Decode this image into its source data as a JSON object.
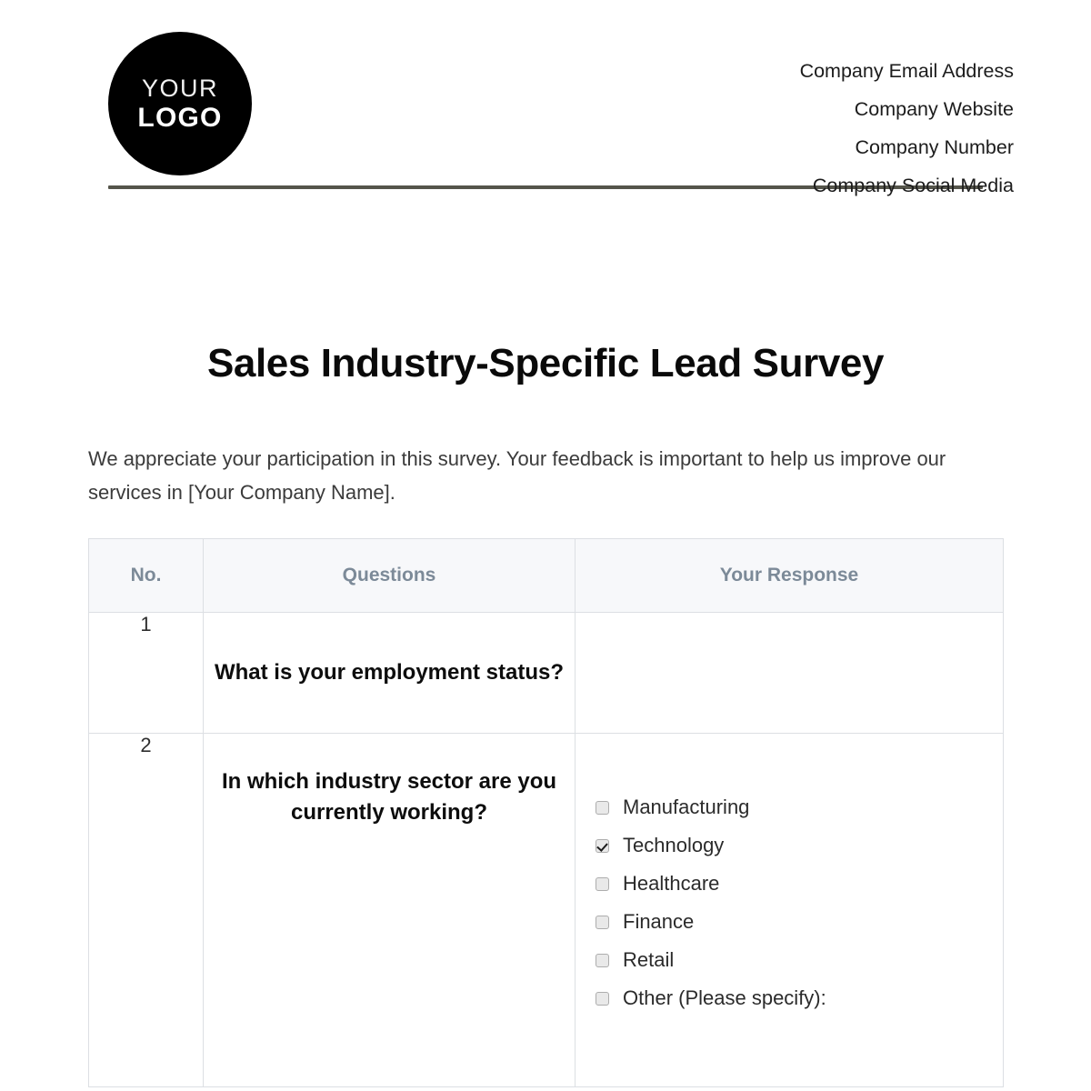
{
  "header": {
    "logo": {
      "top_text": "YOUR",
      "bottom_text": "LOGO",
      "background_color": "#000000",
      "text_color": "#ffffff"
    },
    "contact_lines": [
      "Company Email Address",
      "Company Website",
      "Company Number",
      "Company Social Media"
    ],
    "divider_color": "#55554b"
  },
  "document": {
    "title": "Sales Industry-Specific Lead Survey",
    "intro": "We appreciate your participation in this survey. Your feedback is important to help us improve our services in [Your Company Name]."
  },
  "table": {
    "columns": [
      "No.",
      "Questions",
      "Your Response"
    ],
    "header_text_color": "#7c8a98",
    "header_background": "#f7f8fa",
    "border_color": "#dcdfe3",
    "rows": [
      {
        "no": "1",
        "question": "What is your employment status?",
        "response_type": "blank",
        "options": []
      },
      {
        "no": "2",
        "question": "In which industry sector are you currently working?",
        "response_type": "checkbox-list",
        "options": [
          {
            "label": "Manufacturing",
            "checked": false
          },
          {
            "label": "Technology",
            "checked": true
          },
          {
            "label": "Healthcare",
            "checked": false
          },
          {
            "label": "Finance",
            "checked": false
          },
          {
            "label": "Retail",
            "checked": false
          },
          {
            "label": "Other (Please specify):",
            "checked": false
          }
        ]
      }
    ]
  }
}
